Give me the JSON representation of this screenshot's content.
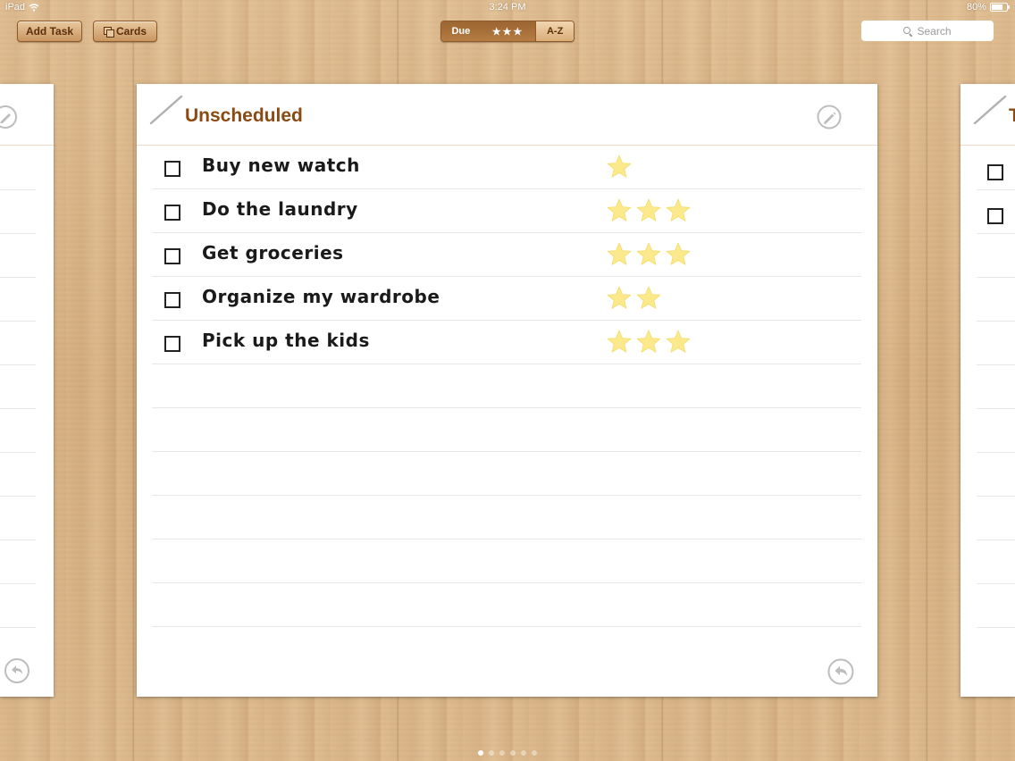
{
  "status": {
    "device": "iPad",
    "time": "3:24 PM",
    "battery": "80%",
    "battery_level": 0.8
  },
  "toolbar": {
    "add_task": "Add Task",
    "cards": "Cards",
    "sort": {
      "due": "Due",
      "stars": "★★★",
      "az": "A-Z",
      "selected": "Due"
    },
    "search_placeholder": "Search"
  },
  "main_card": {
    "title": "Unscheduled",
    "tasks": [
      {
        "text": "Buy new  watch",
        "stars": 1,
        "done": false
      },
      {
        "text": "Do the laundry",
        "stars": 3,
        "done": false
      },
      {
        "text": "Get groceries",
        "stars": 3,
        "done": false
      },
      {
        "text": "Organize my wardrobe",
        "stars": 2,
        "done": false
      },
      {
        "text": "Pick up the kids",
        "stars": 3,
        "done": false
      }
    ]
  },
  "right_card": {
    "title": "T"
  },
  "colors": {
    "title": "#8a4a12",
    "star": "#fbe98c",
    "wood": "#d9b486"
  },
  "pages": {
    "count": 6,
    "current": 1
  }
}
